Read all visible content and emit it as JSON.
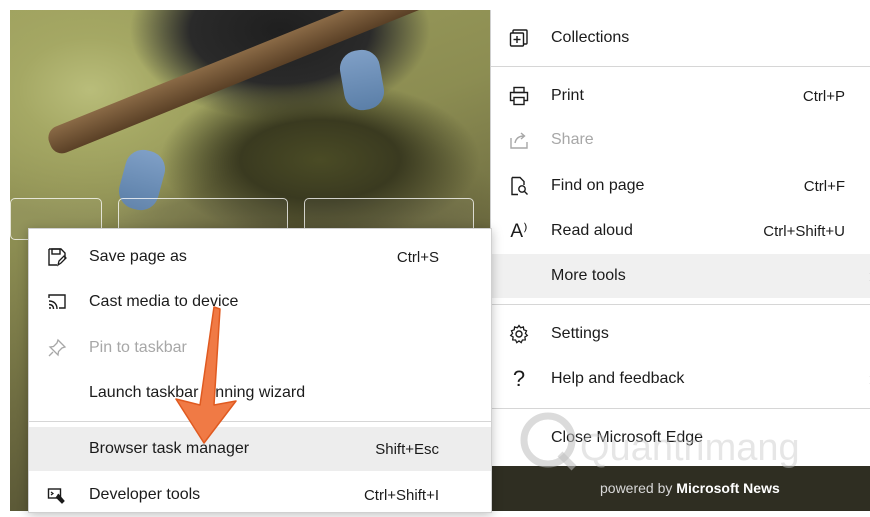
{
  "main_menu": {
    "items": [
      {
        "label": "Collections",
        "shortcut": "",
        "icon": "collections-icon"
      },
      {
        "label": "Print",
        "shortcut": "Ctrl+P",
        "icon": "print-icon"
      },
      {
        "label": "Share",
        "shortcut": "",
        "icon": "share-icon",
        "disabled": true
      },
      {
        "label": "Find on page",
        "shortcut": "Ctrl+F",
        "icon": "find-on-page-icon"
      },
      {
        "label": "Read aloud",
        "shortcut": "Ctrl+Shift+U",
        "icon": "read-aloud-icon",
        "icon_text": "A⁾"
      },
      {
        "label": "More tools",
        "shortcut": "",
        "icon": "",
        "submenu": true
      },
      {
        "label": "Settings",
        "shortcut": "",
        "icon": "gear-icon"
      },
      {
        "label": "Help and feedback",
        "shortcut": "",
        "icon": "help-icon",
        "icon_text": "?",
        "submenu": true
      },
      {
        "label": "Close Microsoft Edge",
        "shortcut": "",
        "icon": ""
      }
    ],
    "chevron": "›"
  },
  "more_tools_submenu": {
    "items": [
      {
        "label": "Save page as",
        "shortcut": "Ctrl+S",
        "icon": "save-page-icon"
      },
      {
        "label": "Cast media to device",
        "shortcut": "",
        "icon": "cast-icon"
      },
      {
        "label": "Pin to taskbar",
        "shortcut": "",
        "icon": "pin-icon",
        "disabled": true
      },
      {
        "label": "Launch taskbar pinning wizard",
        "shortcut": "",
        "icon": ""
      },
      {
        "label": "Browser task manager",
        "shortcut": "Shift+Esc",
        "icon": ""
      },
      {
        "label": "Developer tools",
        "shortcut": "Ctrl+Shift+I",
        "icon": "developer-tools-icon"
      }
    ]
  },
  "news_bar": {
    "prefix": "powered by",
    "brand": "Microsoft News"
  },
  "watermark": {
    "text": "Quantrimang"
  },
  "colors": {
    "arrow": "#f07a45",
    "hover": "#f0f0f0",
    "disabled": "#a7a7a7"
  }
}
